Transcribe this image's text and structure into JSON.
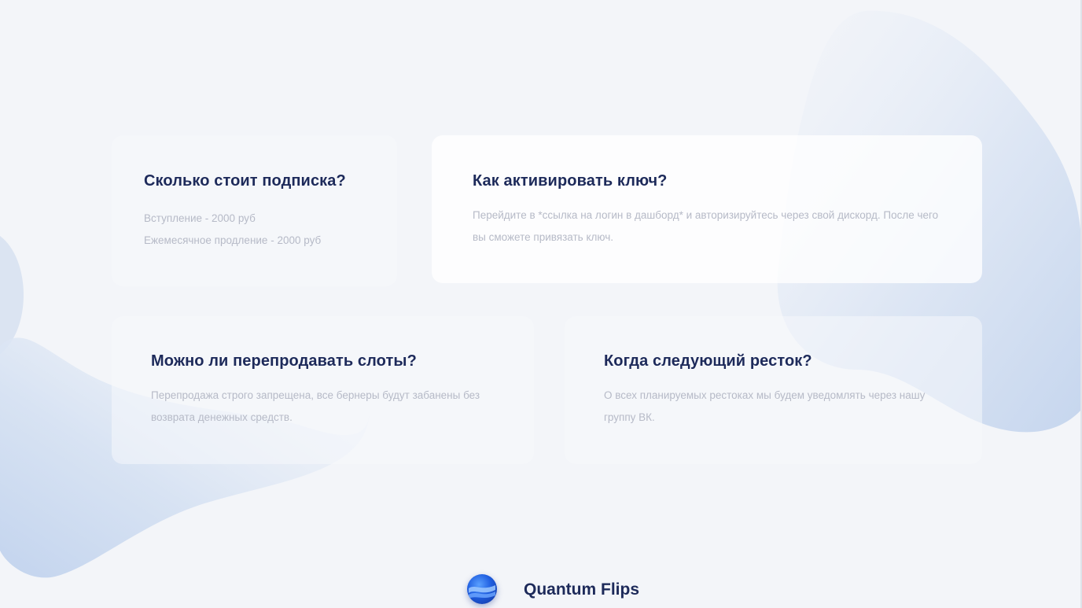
{
  "theme": {
    "title_color": "#1d2a5a",
    "text_color": "#b6bac7",
    "background": "#f3f5f9",
    "accent": "#1f5ee0"
  },
  "faq": [
    {
      "question": "Сколько стоит подписка?",
      "answer_lines": [
        "Вступление - 2000 руб",
        "Ежемесячное продление - 2000 руб"
      ]
    },
    {
      "question": "Как активировать ключ?",
      "answer": "Перейдите в *ссылка на логин в дашборд* и авторизируйтесь через свой дискорд. После чего вы сможете привязать ключ."
    },
    {
      "question": "Можно ли перепродавать слоты?",
      "answer": "Перепродажа строго запрещена, все бернеры будут забанены без возврата денежных средств."
    },
    {
      "question": "Когда следующий ресток?",
      "answer": "О всех планируемых рестоках мы будем уведомлять через нашу группу ВК."
    }
  ],
  "footer": {
    "logo_icon": "quantum-wave-icon",
    "brand_name": "Quantum Flips"
  }
}
